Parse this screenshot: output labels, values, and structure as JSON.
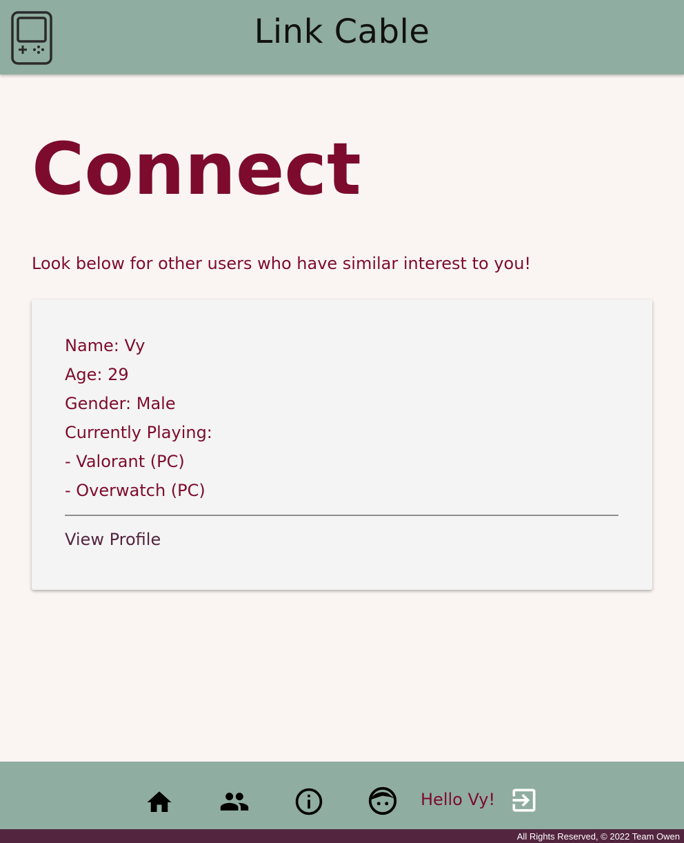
{
  "header": {
    "title": "Link Cable",
    "logo_icon": "handheld-console-icon"
  },
  "main": {
    "heading": "Connect",
    "intro": "Look below for other users who have similar interest to you!"
  },
  "card": {
    "name": "Name: Vy",
    "age": "Age: 29",
    "gender": "Gender: Male",
    "currently_playing": "Currently Playing:",
    "games": [
      "- Valorant (PC)",
      "- Overwatch (PC)"
    ],
    "view_profile": "View Profile"
  },
  "footer": {
    "nav_icons": [
      "home-icon",
      "people-icon",
      "info-icon",
      "face-icon",
      "logout-icon"
    ],
    "greeting": "Hello Vy!",
    "copyright": "All Rights Reserved, © 2022 Team Owen"
  },
  "colors": {
    "header_bg": "#8fada0",
    "accent": "#7d0b2e",
    "footer_bar": "#53253f",
    "page_bg": "#faf5f3"
  }
}
